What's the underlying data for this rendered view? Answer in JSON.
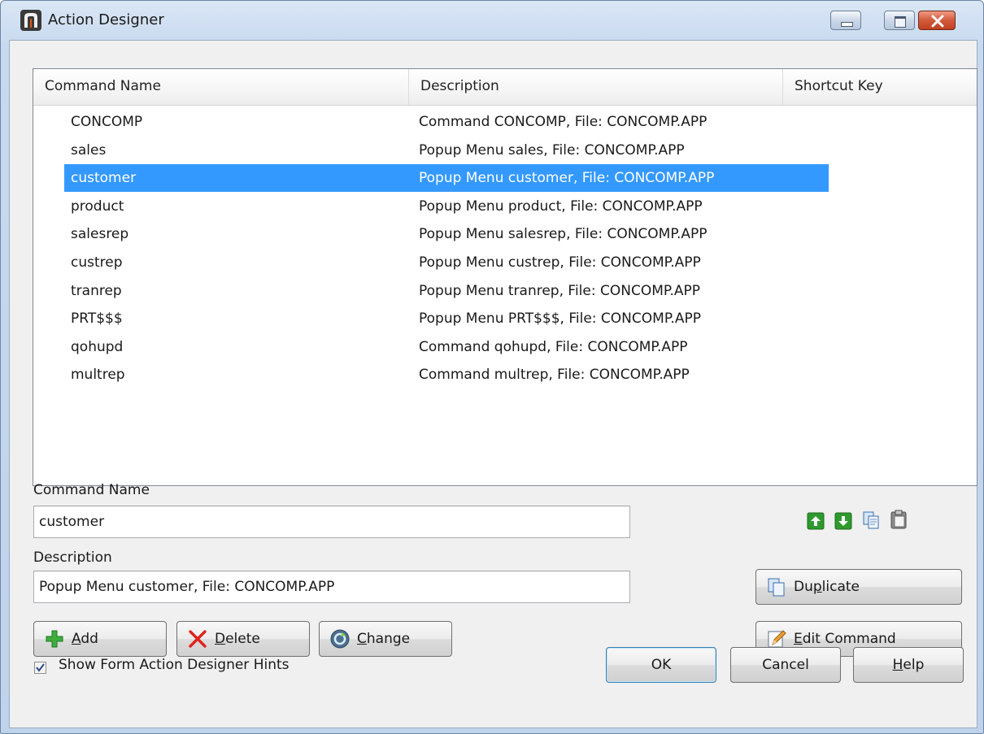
{
  "window": {
    "title": "Action Designer"
  },
  "table": {
    "columns": [
      "Command Name",
      "Description",
      "Shortcut Key"
    ],
    "rows": [
      {
        "name": "CONCOMP",
        "description": "Command CONCOMP, File: CONCOMP.APP",
        "shortcut": "",
        "selected": false
      },
      {
        "name": "sales",
        "description": "Popup Menu sales, File: CONCOMP.APP",
        "shortcut": "",
        "selected": false
      },
      {
        "name": "customer",
        "description": "Popup Menu customer, File: CONCOMP.APP",
        "shortcut": "",
        "selected": true
      },
      {
        "name": "product",
        "description": "Popup Menu product, File: CONCOMP.APP",
        "shortcut": "",
        "selected": false
      },
      {
        "name": "salesrep",
        "description": "Popup Menu salesrep, File: CONCOMP.APP",
        "shortcut": "",
        "selected": false
      },
      {
        "name": "custrep",
        "description": "Popup Menu custrep, File: CONCOMP.APP",
        "shortcut": "",
        "selected": false
      },
      {
        "name": "tranrep",
        "description": "Popup Menu tranrep, File: CONCOMP.APP",
        "shortcut": "",
        "selected": false
      },
      {
        "name": "PRT$$$",
        "description": "Popup Menu PRT$$$, File: CONCOMP.APP",
        "shortcut": "",
        "selected": false
      },
      {
        "name": "qohupd",
        "description": "Command qohupd, File: CONCOMP.APP",
        "shortcut": "",
        "selected": false
      },
      {
        "name": "multrep",
        "description": "Command multrep, File: CONCOMP.APP",
        "shortcut": "",
        "selected": false
      }
    ]
  },
  "form": {
    "command_name_label": "Command Name",
    "command_name_value": "customer",
    "description_label": "Description",
    "description_value": "Popup Menu customer, File: CONCOMP.APP"
  },
  "buttons": {
    "add": {
      "label": "Add",
      "mnemonic": "A",
      "rest": "dd"
    },
    "delete": {
      "label": "Delete",
      "mnemonic": "D",
      "rest": "elete"
    },
    "change": {
      "label": "Change",
      "mnemonic": "C",
      "rest": "hange"
    },
    "duplicate": {
      "label": "Duplicate",
      "pre": "Du",
      "mnemonic": "p",
      "rest": "licate"
    },
    "edit_command": {
      "label": "Edit Command",
      "mnemonic": "E",
      "rest": "dit Command"
    },
    "ok": "OK",
    "cancel": "Cancel",
    "help": {
      "label": "Help",
      "mnemonic": "H",
      "rest": "elp"
    }
  },
  "hints_checkbox": {
    "label": "Show Form Action Designer Hints",
    "checked": true
  },
  "icons": {
    "move_up": "arrow-up-icon",
    "move_down": "arrow-down-icon",
    "copy": "copy-icon",
    "paste": "paste-icon",
    "app": "app-logo-icon",
    "add": "plus-icon",
    "delete": "x-icon",
    "change": "refresh-icon",
    "duplicate": "copy-icon",
    "edit": "pencil-icon"
  },
  "colors": {
    "selection": "#3399ff",
    "arrow_green": "#2e9a2e"
  }
}
